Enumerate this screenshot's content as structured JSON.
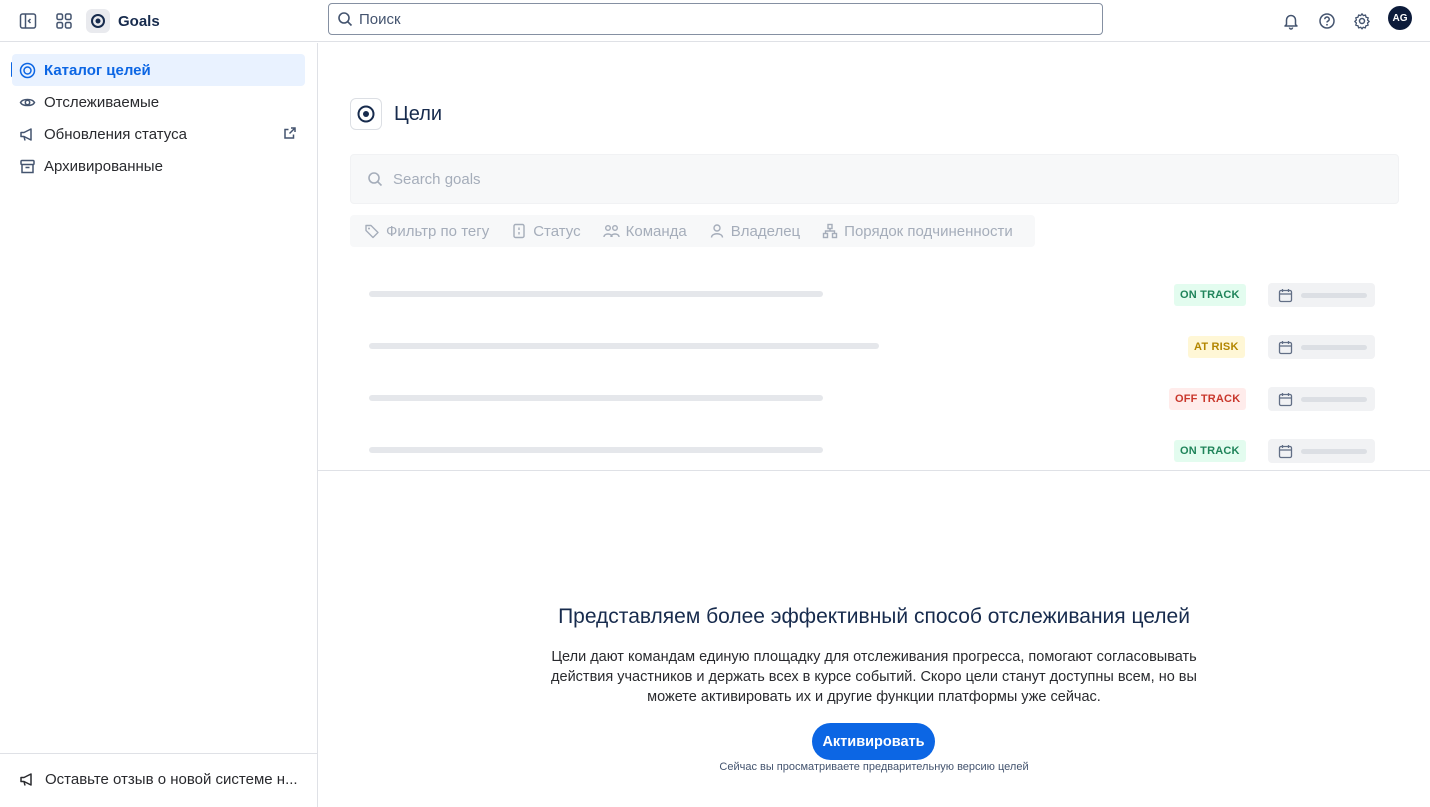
{
  "topbar": {
    "app_name": "Goals",
    "search_placeholder": "Поиск",
    "avatar_initials": "AG",
    "icons": [
      "sidebar-toggle-icon",
      "app-grid-icon",
      "bell-icon",
      "help-icon",
      "settings-icon"
    ]
  },
  "sidebar": {
    "items": [
      {
        "label": "Каталог целей",
        "icon": "target-icon",
        "active": true
      },
      {
        "label": "Отслеживаемые",
        "icon": "eye-icon",
        "active": false
      },
      {
        "label": "Обновления статуса",
        "icon": "megaphone-icon",
        "active": false,
        "external": true
      },
      {
        "label": "Архивированные",
        "icon": "archive-icon",
        "active": false
      }
    ],
    "footer_label": "Оставьте отзыв о новой системе н..."
  },
  "main": {
    "title": "Цели",
    "search_placeholder": "Search goals",
    "filters": [
      {
        "label": "Фильтр по тегу",
        "icon": "tag-icon"
      },
      {
        "label": "Статус",
        "icon": "status-icon"
      },
      {
        "label": "Команда",
        "icon": "team-icon"
      },
      {
        "label": "Владелец",
        "icon": "person-icon"
      },
      {
        "label": "Порядок подчиненности",
        "icon": "hierarchy-icon"
      }
    ],
    "rows": [
      {
        "status": "ON TRACK",
        "kind": "on"
      },
      {
        "status": "AT RISK",
        "kind": "risk"
      },
      {
        "status": "OFF TRACK",
        "kind": "off"
      },
      {
        "status": "ON TRACK",
        "kind": "on"
      }
    ],
    "promo": {
      "title": "Представляем более эффективный способ отслеживания целей",
      "body": "Цели дают командам единую площадку для отслеживания прогресса, помогают согласовывать действия участников и держать всех в курсе событий. Скоро цели станут доступны всем, но вы можете активировать их и другие функции платформы уже сейчас.",
      "button": "Активировать",
      "note": "Сейчас вы просматриваете предварительную версию целей"
    }
  },
  "colors": {
    "accent": "#0c66e4",
    "on_track": "#1f845a",
    "at_risk": "#b38600",
    "off_track": "#c9372c"
  }
}
